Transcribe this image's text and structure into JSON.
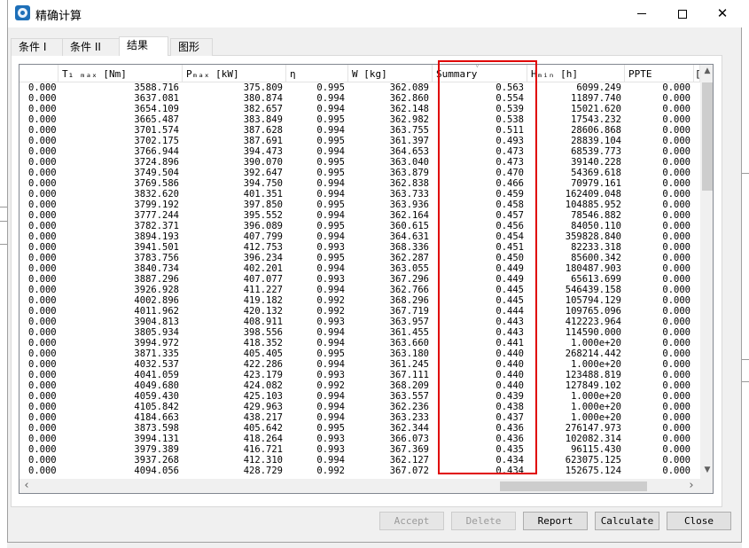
{
  "window": {
    "title": "精确计算"
  },
  "tabs": [
    {
      "label": "条件 I",
      "active": false
    },
    {
      "label": "条件 II",
      "active": false
    },
    {
      "label": "结果",
      "active": true
    },
    {
      "label": "图形",
      "active": false
    }
  ],
  "table": {
    "columns": [
      "",
      "T₁ ₘₐₓ [Nm]",
      "Pₘₐₓ [kW]",
      "η",
      "W [kg]",
      "Summary",
      "Hₘᵢₙ [h]",
      "PPTE",
      "["
    ],
    "rows": [
      [
        "0.000",
        "3588.716",
        "375.809",
        "0.995",
        "362.089",
        "0.563",
        "6099.249",
        "0.000"
      ],
      [
        "0.000",
        "3637.081",
        "380.874",
        "0.994",
        "362.860",
        "0.554",
        "11897.740",
        "0.000"
      ],
      [
        "0.000",
        "3654.109",
        "382.657",
        "0.994",
        "362.148",
        "0.539",
        "15021.620",
        "0.000"
      ],
      [
        "0.000",
        "3665.487",
        "383.849",
        "0.995",
        "362.982",
        "0.538",
        "17543.232",
        "0.000"
      ],
      [
        "0.000",
        "3701.574",
        "387.628",
        "0.994",
        "363.755",
        "0.511",
        "28606.868",
        "0.000"
      ],
      [
        "0.000",
        "3702.175",
        "387.691",
        "0.995",
        "361.397",
        "0.493",
        "28839.104",
        "0.000"
      ],
      [
        "0.000",
        "3766.944",
        "394.473",
        "0.994",
        "364.653",
        "0.473",
        "68539.773",
        "0.000"
      ],
      [
        "0.000",
        "3724.896",
        "390.070",
        "0.995",
        "363.040",
        "0.473",
        "39140.228",
        "0.000"
      ],
      [
        "0.000",
        "3749.504",
        "392.647",
        "0.995",
        "363.879",
        "0.470",
        "54369.618",
        "0.000"
      ],
      [
        "0.000",
        "3769.586",
        "394.750",
        "0.994",
        "362.838",
        "0.466",
        "70979.161",
        "0.000"
      ],
      [
        "0.000",
        "3832.620",
        "401.351",
        "0.994",
        "363.733",
        "0.459",
        "162409.048",
        "0.000"
      ],
      [
        "0.000",
        "3799.192",
        "397.850",
        "0.995",
        "363.936",
        "0.458",
        "104885.952",
        "0.000"
      ],
      [
        "0.000",
        "3777.244",
        "395.552",
        "0.994",
        "362.164",
        "0.457",
        "78546.882",
        "0.000"
      ],
      [
        "0.000",
        "3782.371",
        "396.089",
        "0.995",
        "360.615",
        "0.456",
        "84050.110",
        "0.000"
      ],
      [
        "0.000",
        "3894.193",
        "407.799",
        "0.994",
        "364.631",
        "0.454",
        "359828.840",
        "0.000"
      ],
      [
        "0.000",
        "3941.501",
        "412.753",
        "0.993",
        "368.336",
        "0.451",
        "82233.318",
        "0.000"
      ],
      [
        "0.000",
        "3783.756",
        "396.234",
        "0.995",
        "362.287",
        "0.450",
        "85600.342",
        "0.000"
      ],
      [
        "0.000",
        "3840.734",
        "402.201",
        "0.994",
        "363.055",
        "0.449",
        "180487.903",
        "0.000"
      ],
      [
        "0.000",
        "3887.296",
        "407.077",
        "0.993",
        "367.296",
        "0.449",
        "65613.699",
        "0.000"
      ],
      [
        "0.000",
        "3926.928",
        "411.227",
        "0.994",
        "362.766",
        "0.445",
        "546439.158",
        "0.000"
      ],
      [
        "0.000",
        "4002.896",
        "419.182",
        "0.992",
        "368.296",
        "0.445",
        "105794.129",
        "0.000"
      ],
      [
        "0.000",
        "4011.962",
        "420.132",
        "0.992",
        "367.719",
        "0.444",
        "109765.096",
        "0.000"
      ],
      [
        "0.000",
        "3904.813",
        "408.911",
        "0.993",
        "363.957",
        "0.443",
        "412223.964",
        "0.000"
      ],
      [
        "0.000",
        "3805.934",
        "398.556",
        "0.994",
        "361.455",
        "0.443",
        "114590.000",
        "0.000"
      ],
      [
        "0.000",
        "3994.972",
        "418.352",
        "0.994",
        "363.660",
        "0.441",
        "1.000e+20",
        "0.000"
      ],
      [
        "0.000",
        "3871.335",
        "405.405",
        "0.995",
        "363.180",
        "0.440",
        "268214.442",
        "0.000"
      ],
      [
        "0.000",
        "4032.537",
        "422.286",
        "0.994",
        "361.245",
        "0.440",
        "1.000e+20",
        "0.000"
      ],
      [
        "0.000",
        "4041.059",
        "423.179",
        "0.993",
        "367.111",
        "0.440",
        "123488.819",
        "0.000"
      ],
      [
        "0.000",
        "4049.680",
        "424.082",
        "0.992",
        "368.209",
        "0.440",
        "127849.102",
        "0.000"
      ],
      [
        "0.000",
        "4059.430",
        "425.103",
        "0.994",
        "363.557",
        "0.439",
        "1.000e+20",
        "0.000"
      ],
      [
        "0.000",
        "4105.842",
        "429.963",
        "0.994",
        "362.236",
        "0.438",
        "1.000e+20",
        "0.000"
      ],
      [
        "0.000",
        "4184.663",
        "438.217",
        "0.994",
        "363.233",
        "0.437",
        "1.000e+20",
        "0.000"
      ],
      [
        "0.000",
        "3873.598",
        "405.642",
        "0.995",
        "362.344",
        "0.436",
        "276147.973",
        "0.000"
      ],
      [
        "0.000",
        "3994.131",
        "418.264",
        "0.993",
        "366.073",
        "0.436",
        "102082.314",
        "0.000"
      ],
      [
        "0.000",
        "3979.389",
        "416.721",
        "0.993",
        "367.369",
        "0.435",
        "96115.430",
        "0.000"
      ],
      [
        "0.000",
        "3937.268",
        "412.310",
        "0.994",
        "362.127",
        "0.434",
        "623075.125",
        "0.000"
      ],
      [
        "0.000",
        "4094.056",
        "428.729",
        "0.992",
        "367.072",
        "0.434",
        "152675.124",
        "0.000"
      ]
    ]
  },
  "scroll": {
    "up": "▲",
    "down": "▼",
    "left": "‹",
    "right": "›",
    "sort": "▽"
  },
  "buttons": {
    "accept": "Accept",
    "delete": "Delete",
    "report": "Report",
    "calculate": "Calculate",
    "close": "Close"
  },
  "highlight_color": "#e00000"
}
